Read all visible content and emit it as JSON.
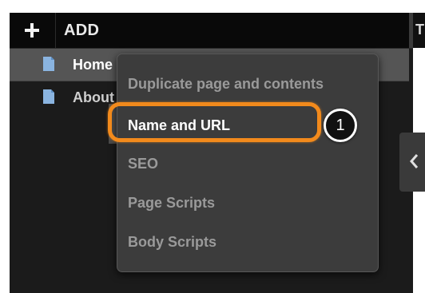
{
  "toolbar": {
    "add_label": "ADD"
  },
  "content": {
    "header_partial": "T"
  },
  "tree": {
    "items": [
      {
        "label": "Home"
      },
      {
        "label": "About"
      }
    ]
  },
  "context_menu": {
    "items": [
      {
        "label": "Duplicate page and contents"
      },
      {
        "label": "Name and URL"
      },
      {
        "label": "SEO"
      },
      {
        "label": "Page Scripts"
      },
      {
        "label": "Body Scripts"
      }
    ],
    "highlighted_item": "Name and URL"
  },
  "callout": {
    "number": "1",
    "color": "#f28a1c"
  },
  "colors": {
    "panel_bg": "#1b1b1b",
    "toolbar_bg": "#090909",
    "menu_bg": "#3c3c3c",
    "accent": "#f28a1c"
  }
}
